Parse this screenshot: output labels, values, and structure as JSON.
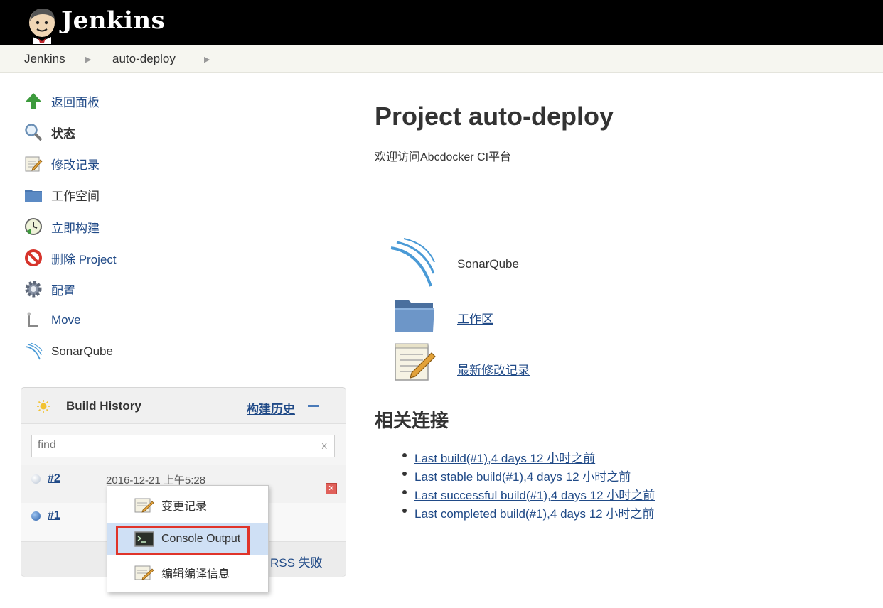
{
  "header": {
    "logo_text": "Jenkins"
  },
  "breadcrumbs": [
    "Jenkins",
    "auto-deploy"
  ],
  "sidebar": {
    "tasks": [
      {
        "label": "返回面板",
        "icon": "up-arrow-icon"
      },
      {
        "label": "状态",
        "icon": "search-icon"
      },
      {
        "label": "修改记录",
        "icon": "notepad-icon"
      },
      {
        "label": "工作空间",
        "icon": "folder-icon"
      },
      {
        "label": "立即构建",
        "icon": "build-clock-icon"
      },
      {
        "label": "删除 Project",
        "icon": "no-entry-icon"
      },
      {
        "label": "配置",
        "icon": "gear-icon"
      },
      {
        "label": "Move",
        "icon": "move-icon"
      },
      {
        "label": "SonarQube",
        "icon": "sonarqube-icon"
      }
    ]
  },
  "build_history": {
    "title": "Build History",
    "trend_link": "构建历史",
    "search_placeholder": "find",
    "clear_label": "x",
    "builds": [
      {
        "number": "#2",
        "date": "2016-12-21 上午5:28"
      },
      {
        "number": "#1",
        "date": ""
      }
    ],
    "rss_label": "RSS 失败"
  },
  "context_menu": {
    "items": [
      {
        "label": "变更记录",
        "icon": "notepad-icon"
      },
      {
        "label": "Console Output",
        "icon": "terminal-icon"
      },
      {
        "label": "编辑编译信息",
        "icon": "notepad-icon"
      }
    ]
  },
  "main": {
    "title": "Project auto-deploy",
    "description": "欢迎访问Abcdocker CI平台",
    "actions": [
      {
        "label": "SonarQube",
        "icon": "sonarqube-icon"
      },
      {
        "label": "工作区",
        "icon": "folder-icon"
      },
      {
        "label": "最新修改记录",
        "icon": "notepad-icon"
      }
    ],
    "related_heading": "相关连接",
    "related_links": [
      "Last build(#1),4 days 12 小时之前",
      "Last stable build(#1),4 days 12 小时之前",
      "Last successful build(#1),4 days 12 小时之前",
      "Last completed build(#1),4 days 12 小时之前"
    ]
  },
  "colors": {
    "header_bg": "#000000",
    "link": "#204a87",
    "highlight": "#cfe0f5",
    "highlight_border": "#e0342a"
  }
}
